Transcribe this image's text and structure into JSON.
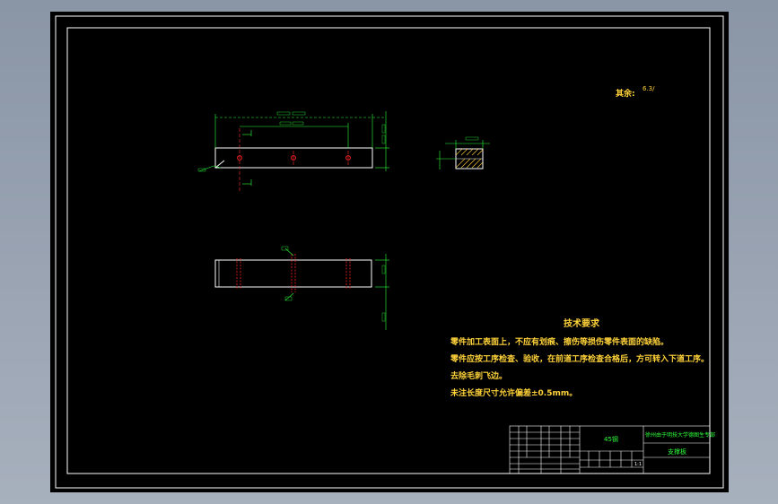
{
  "roughness_note": {
    "label": "其余:",
    "value": "6.3/"
  },
  "tech_requirements": {
    "title": "技术要求",
    "items": [
      "零件加工表面上，不应有划痕、擦伤等损伤零件表面的缺陷。",
      "零件应按工序检查、验收，在前道工序检查合格后，方可转入下道工序。",
      "去除毛刺飞边。",
      "未注长度尺寸允许偏差±0.5mm。"
    ]
  },
  "title_block": {
    "material": "45钢",
    "school": "徐州由于明技大学德图生专部",
    "part_name": "支撑板",
    "scale": "1:1"
  },
  "colors": {
    "background": "#000000",
    "outline": "#ffffff",
    "dimension": "#2dff3a",
    "text": "#ffd23a",
    "hole_mark": "#ff2020"
  }
}
